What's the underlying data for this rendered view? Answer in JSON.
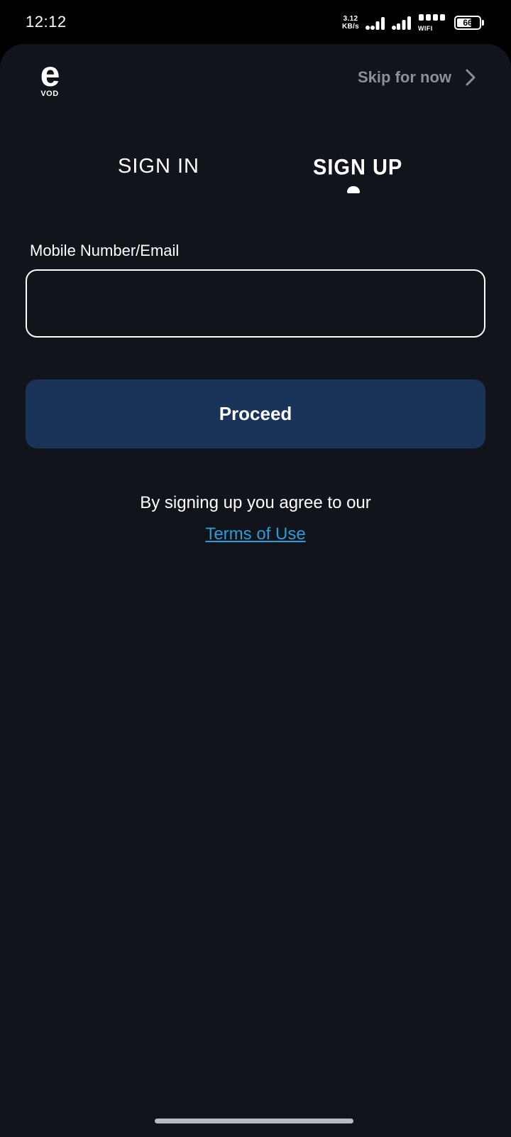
{
  "status_bar": {
    "time": "12:12",
    "net_speed_value": "3.12",
    "net_speed_unit": "KB/s",
    "wifi_label": "WIFI",
    "battery_level": "66",
    "battery_fraction": 0.66
  },
  "header": {
    "logo_letter": "e",
    "logo_sub": "VOD",
    "skip_label": "Skip for now",
    "skip_icon": "chevron-right-icon"
  },
  "tabs": [
    {
      "label": "SIGN IN",
      "active": false
    },
    {
      "label": "SIGN UP",
      "active": true
    }
  ],
  "form": {
    "field_label": "Mobile Number/Email",
    "field_value": "",
    "field_placeholder": "",
    "proceed_label": "Proceed"
  },
  "footer": {
    "agreement_text": "By signing up you agree to our",
    "terms_label": "Terms of Use"
  },
  "colors": {
    "background": "#11141b",
    "button": "#1a3359",
    "link": "#2e9bd6",
    "muted": "#8c8f95"
  }
}
